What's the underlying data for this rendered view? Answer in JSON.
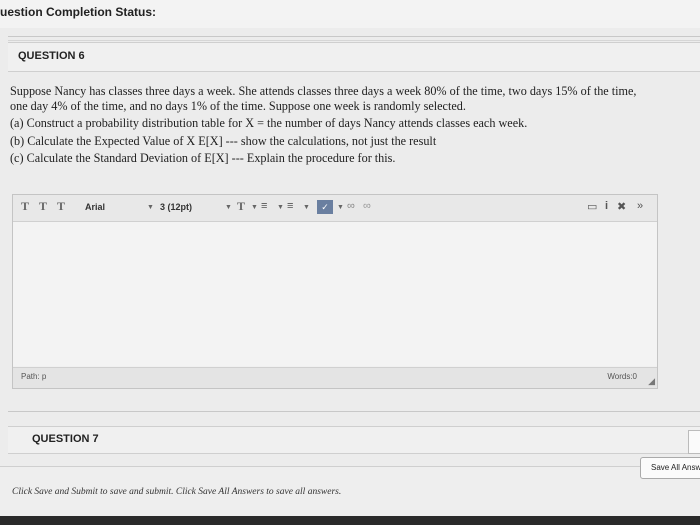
{
  "status": {
    "title": "uestion Completion Status:"
  },
  "question6": {
    "label": "QUESTION 6",
    "text": {
      "line1": "Suppose Nancy has classes three days a week. She attends classes three days a week 80% of the time, two days 15% of the time,",
      "line2": "one day 4% of the time, and no days 1% of the time. Suppose one week is randomly selected.",
      "part_a": "(a) Construct a probability distribution table for X = the number of days Nancy attends classes each week.",
      "part_b": "(b) Calculate the Expected Value of X E[X] --- show the calculations, not just the result",
      "part_c": "(c) Calculate the Standard Deviation of E[X] --- Explain the procedure for this."
    }
  },
  "editor": {
    "toolbar": {
      "t1": "T",
      "t2": "T",
      "t3": "T",
      "font_family": "Arial",
      "font_size": "3 (12pt)",
      "text_color": "T"
    },
    "path": "Path: p",
    "words": "Words:0",
    "content": ""
  },
  "question7": {
    "label": "QUESTION 7"
  },
  "footer": {
    "instructions": "Click Save and Submit to save and submit. Click Save All Answers to save all answers.",
    "save_all_label": "Save All Answ"
  }
}
